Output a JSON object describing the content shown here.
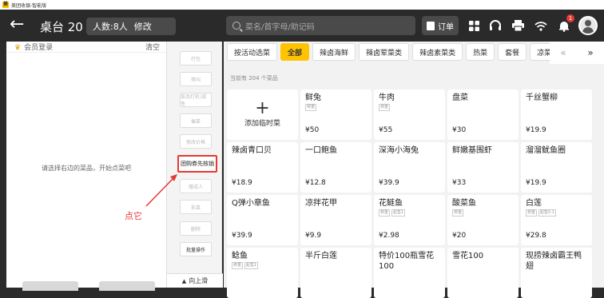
{
  "window": {
    "title": "美团收银-智能版",
    "app_icon_text": "美"
  },
  "header": {
    "table_name": "桌台 20",
    "people": "人数:8人",
    "modify": "修改",
    "search_placeholder": "菜名/首字母/助记码",
    "order_label": "订单",
    "notification_count": "1"
  },
  "left_panel": {
    "member_login": "会员登录",
    "clear": "清空",
    "empty_tip": "请选择右边的菜品，开始点菜吧"
  },
  "actions": {
    "items": [
      "打包",
      "等叫",
      "菜品打折/减免",
      "催菜",
      "修改价格",
      "团购券先核销",
      "赠成人",
      "拆菜",
      "删除",
      "批量操作"
    ],
    "scroll_up": "向上滑"
  },
  "annotation": {
    "text": "点它",
    "color": "#e53935"
  },
  "categories": {
    "tabs": [
      "按活动选菜",
      "全部",
      "辣卤海鲜",
      "辣卤荤菜类",
      "辣卤素菜类",
      "热菜",
      "套餐",
      "凉菜"
    ],
    "active_index": 1,
    "prev": "«",
    "next": "»"
  },
  "menu": {
    "count_text": "当前有 204 个菜品",
    "add_temp": "添加临时菜",
    "dishes": [
      {
        "name": "鲜兔",
        "tags": [
          "称重"
        ],
        "price": "¥50"
      },
      {
        "name": "牛肉",
        "tags": [
          "称重"
        ],
        "price": "¥55"
      },
      {
        "name": "盘菜",
        "tags": [],
        "price": "¥30"
      },
      {
        "name": "千丝蟹柳",
        "tags": [],
        "price": "¥19.9"
      },
      {
        "name": "辣卤青口贝",
        "tags": [],
        "price": "¥18.9"
      },
      {
        "name": "一口鲍鱼",
        "tags": [],
        "price": "¥12.8"
      },
      {
        "name": "深海小海兔",
        "tags": [],
        "price": "¥39.9"
      },
      {
        "name": "鲜嫩基围虾",
        "tags": [],
        "price": "¥33"
      },
      {
        "name": "溜溜鱿鱼圈",
        "tags": [],
        "price": "¥19.9"
      },
      {
        "name": "Q弹小章鱼",
        "tags": [],
        "price": "¥39.9"
      },
      {
        "name": "凉拌花甲",
        "tags": [],
        "price": "¥9.9"
      },
      {
        "name": "花鲢鱼",
        "tags": [
          "称重",
          "起售1"
        ],
        "price": "¥2.98"
      },
      {
        "name": "酸菜鱼",
        "tags": [
          "称重"
        ],
        "price": "¥20"
      },
      {
        "name": "白莲",
        "tags": [
          "称重",
          "起售0.1"
        ],
        "price": "¥29.8"
      },
      {
        "name": "鲶鱼",
        "tags": [
          "称重",
          "起售1"
        ],
        "price": ""
      },
      {
        "name": "半斤白莲",
        "tags": [],
        "price": ""
      },
      {
        "name": "特价100瓶雪花100",
        "tags": [],
        "price": ""
      },
      {
        "name": "雪花100",
        "tags": [],
        "price": ""
      },
      {
        "name": "现捞辣卤霸王鸭翅",
        "tags": [],
        "price": ""
      }
    ]
  }
}
